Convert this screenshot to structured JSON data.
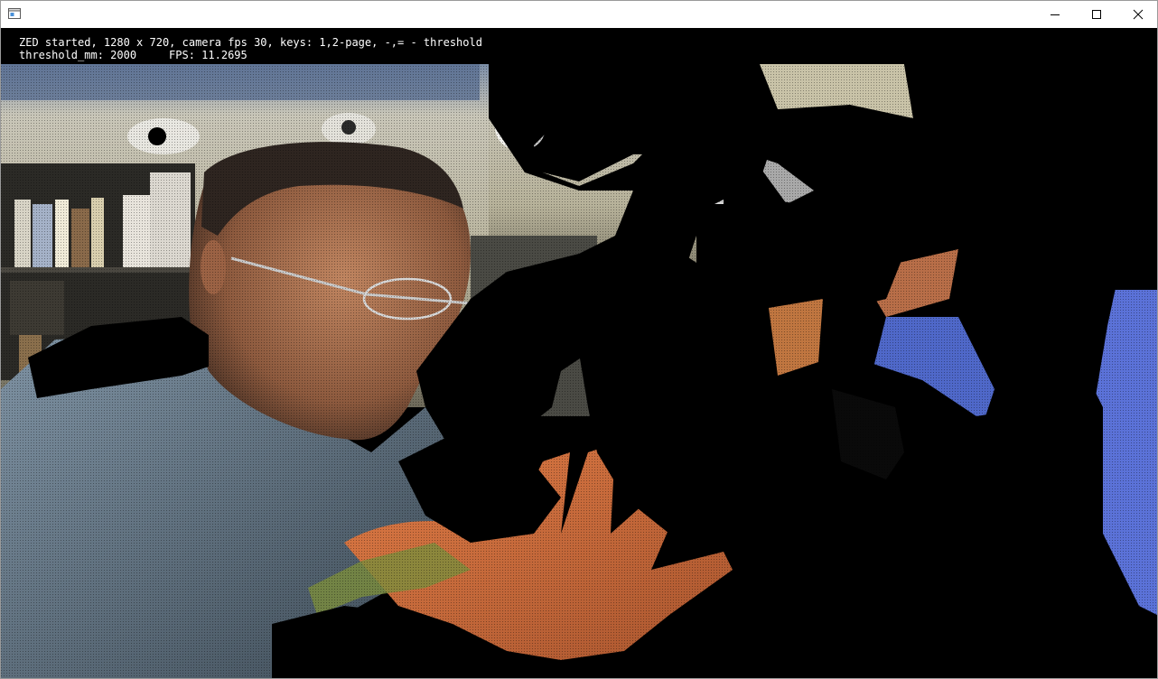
{
  "window": {
    "title": "",
    "icon": "app-window-icon",
    "controls": {
      "minimize": "minimize-icon",
      "maximize": "maximize-icon",
      "close": "close-icon"
    }
  },
  "overlay": {
    "status_line": "ZED started, 1280 x 720, camera fps 30, keys: 1,2-page, -,= - threshold",
    "threshold_label": "threshold_mm: 2000",
    "fps_label": "FPS: 11.2695"
  },
  "colors": {
    "background": "#000000",
    "overlay_text": "#ffffff",
    "skin": "#b06a45",
    "hand": "#d86a38",
    "shirt": "#7d8b95",
    "blue_object": "#5b72d8",
    "wall": "#c9c3a8"
  }
}
